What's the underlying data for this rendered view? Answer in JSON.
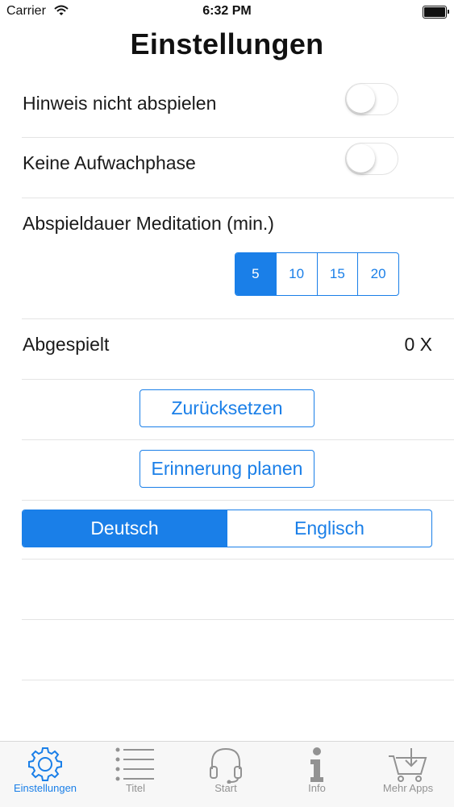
{
  "status": {
    "carrier": "Carrier",
    "time": "6:32 PM"
  },
  "page_title": "Einstellungen",
  "settings": {
    "hinweis": {
      "label": "Hinweis nicht abspielen",
      "on": false
    },
    "aufwach": {
      "label": "Keine Aufwachphase",
      "on": false
    },
    "duration": {
      "label": "Abspieldauer Meditation (min.)",
      "options": [
        "5",
        "10",
        "15",
        "20"
      ],
      "selected": "5"
    },
    "played": {
      "label": "Abgespielt",
      "value": "0 X"
    },
    "reset_label": "Zurücksetzen",
    "reminder_label": "Erinnerung planen",
    "language": {
      "options": [
        "Deutsch",
        "Englisch"
      ],
      "selected": "Deutsch"
    }
  },
  "tabs": [
    {
      "label": "Einstellungen",
      "icon": "gear-icon",
      "active": true
    },
    {
      "label": "Titel",
      "icon": "list-icon",
      "active": false
    },
    {
      "label": "Start",
      "icon": "headphones-icon",
      "active": false
    },
    {
      "label": "Info",
      "icon": "info-icon",
      "active": false
    },
    {
      "label": "Mehr Apps",
      "icon": "cart-icon",
      "active": false
    }
  ],
  "colors": {
    "accent": "#1a7fe8",
    "inactive": "#929292",
    "separator": "#e4e4e4"
  }
}
